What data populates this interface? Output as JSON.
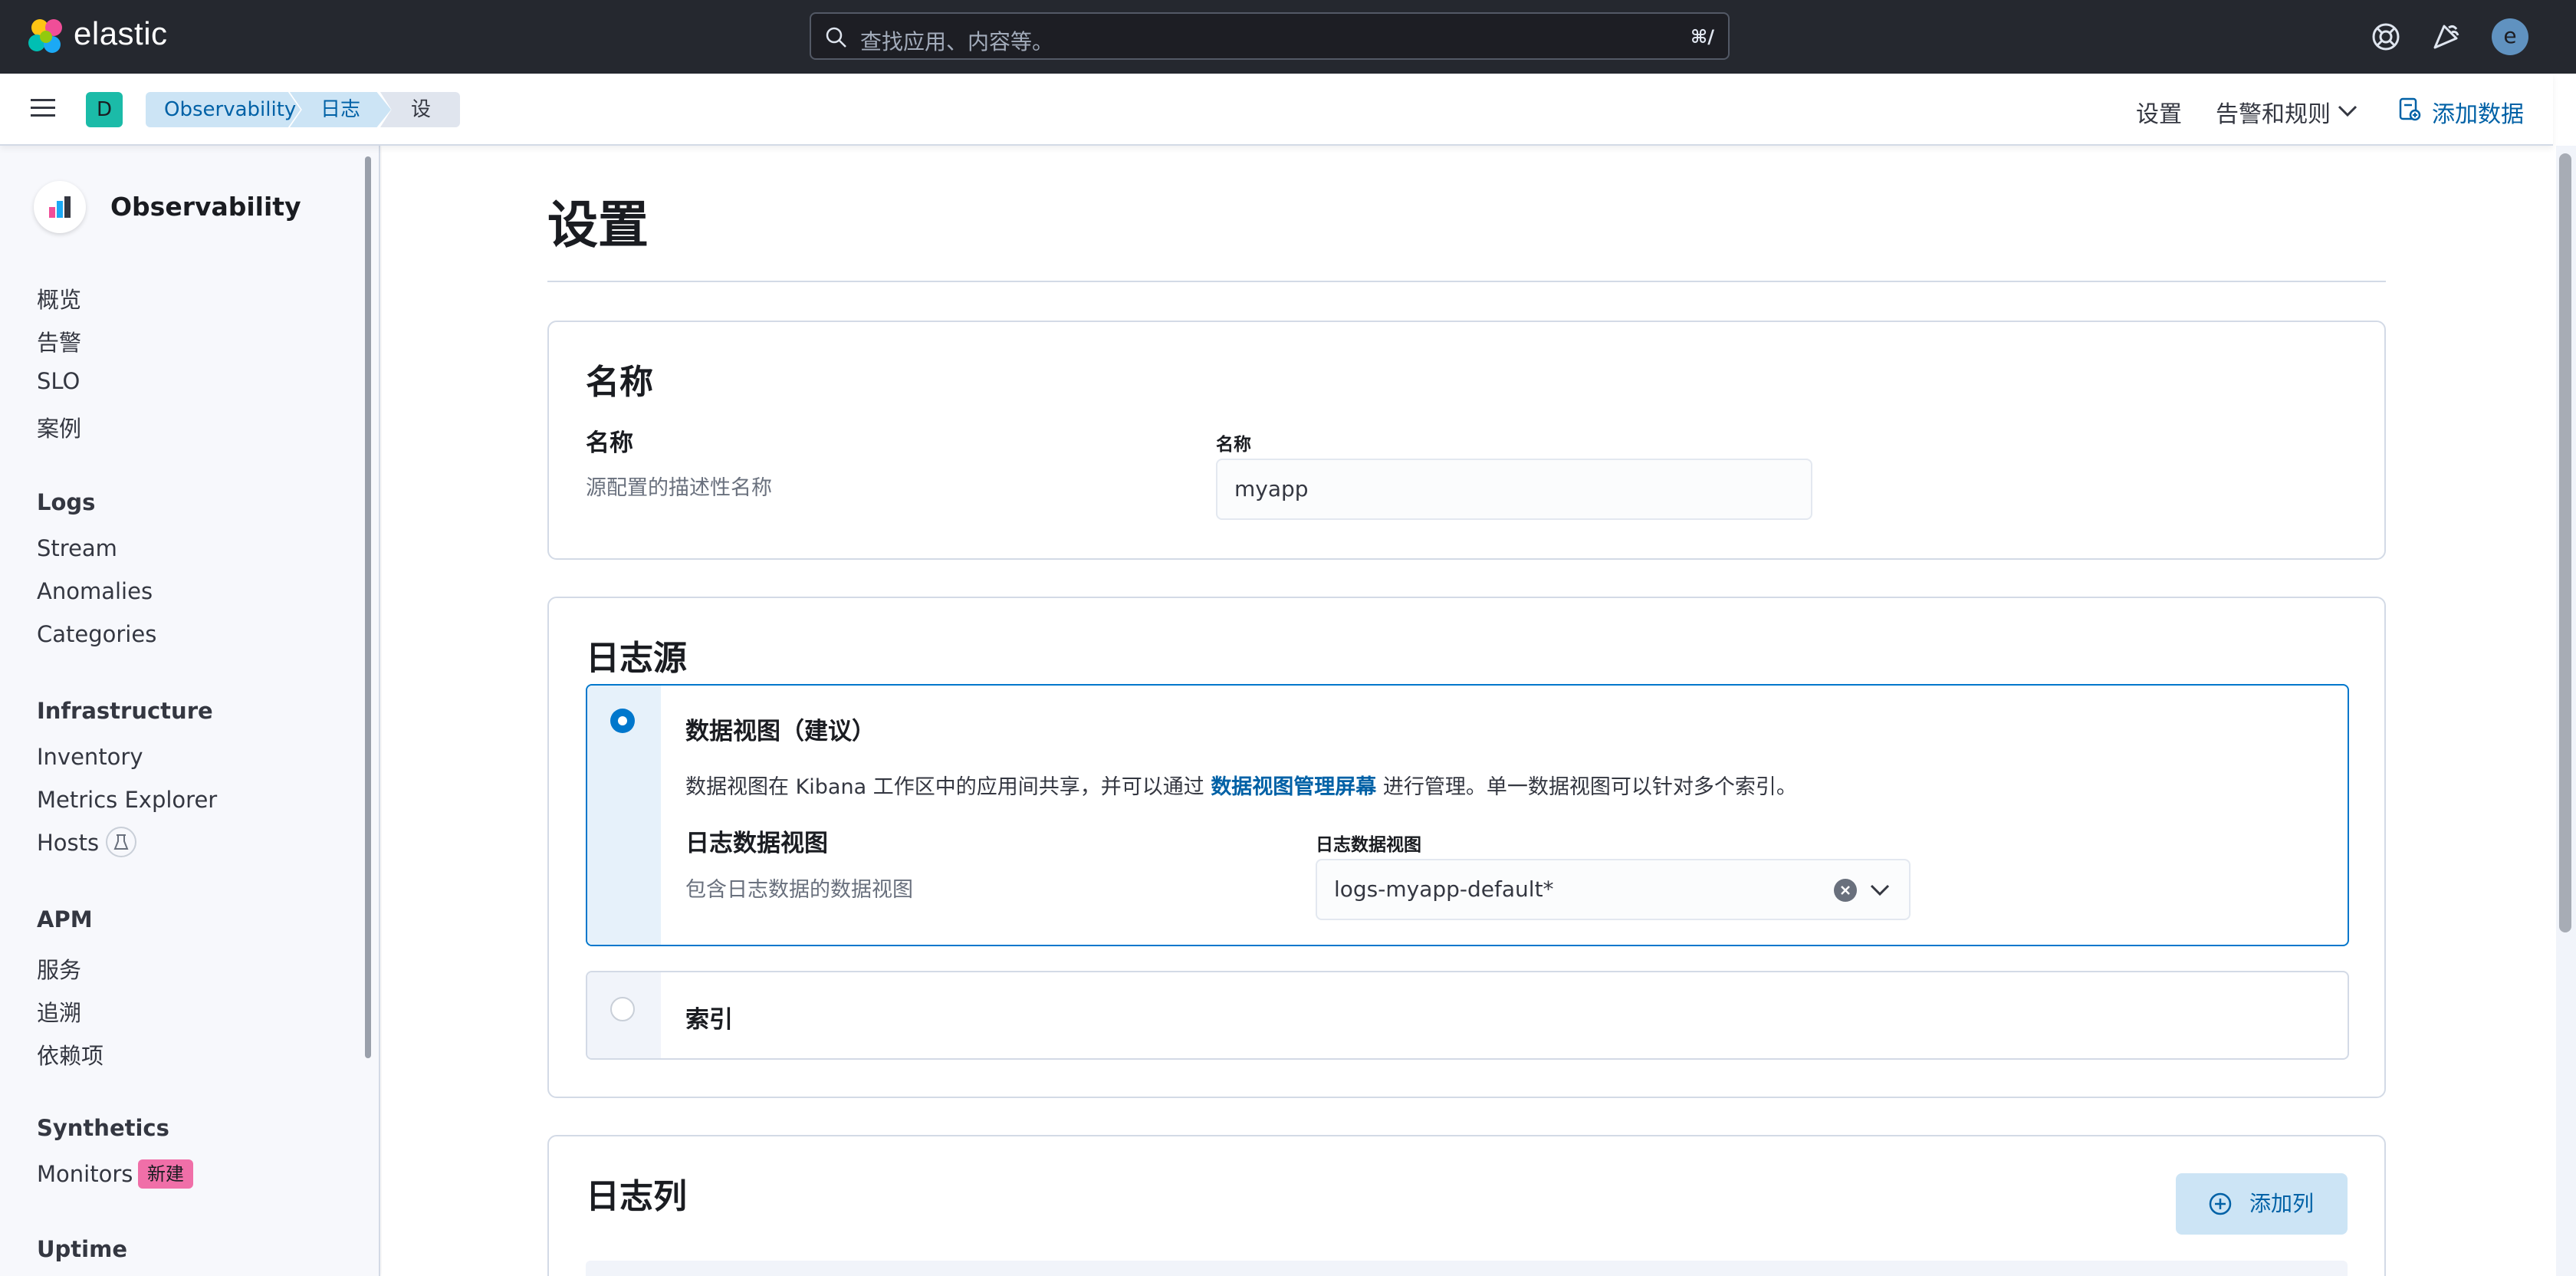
{
  "header": {
    "brand": "elastic",
    "search_placeholder": "查找应用、内容等。",
    "search_shortcut": "⌘/",
    "avatar_initial": "e"
  },
  "subheader": {
    "space_initial": "D",
    "breadcrumbs": [
      "Observability",
      "日志",
      "设置"
    ],
    "settings_link": "设置",
    "alerts_menu": "告警和规则",
    "add_data": "添加数据"
  },
  "sidebar": {
    "app_title": "Observability",
    "general": [
      "概览",
      "告警",
      "SLO",
      "案例"
    ],
    "logs": {
      "title": "Logs",
      "items": [
        "Stream",
        "Anomalies",
        "Categories"
      ]
    },
    "infrastructure": {
      "title": "Infrastructure",
      "items": [
        "Inventory",
        "Metrics Explorer",
        "Hosts"
      ]
    },
    "apm": {
      "title": "APM",
      "items": [
        "服务",
        "追溯",
        "依赖项"
      ]
    },
    "synthetics": {
      "title": "Synthetics",
      "items": [
        "Monitors"
      ],
      "new_badge": "新建"
    },
    "uptime": {
      "title": "Uptime"
    }
  },
  "page": {
    "title": "设置",
    "name_panel": {
      "title": "名称",
      "field_title": "名称",
      "field_desc": "源配置的描述性名称",
      "label": "名称",
      "value": "myapp"
    },
    "log_source_panel": {
      "title": "日志源",
      "data_view_option": {
        "title": "数据视图（建议）",
        "desc_before": "数据视图在 Kibana 工作区中的应用间共享，并可以通过",
        "desc_link": "数据视图管理屏幕",
        "desc_after": "进行管理。单一数据视图可以针对多个索引。",
        "field_title": "日志数据视图",
        "field_desc": "包含日志数据的数据视图",
        "label": "日志数据视图",
        "value": "logs-myapp-default*"
      },
      "index_option": {
        "title": "索引"
      }
    },
    "columns_panel": {
      "title": "日志列",
      "add_column": "添加列"
    }
  },
  "colors": {
    "header_bg": "#25282f",
    "accent": "#0077cc",
    "link": "#0061a6",
    "badge_pink": "#f06fa8",
    "space_teal": "#1bbba8"
  }
}
